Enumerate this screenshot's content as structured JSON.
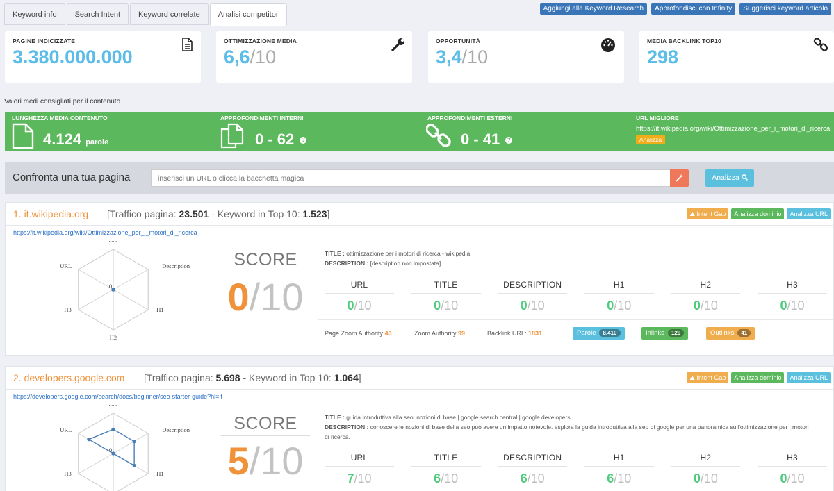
{
  "tabs": [
    "Keyword info",
    "Search Intent",
    "Keyword correlate",
    "Analisi competitor"
  ],
  "top_buttons": [
    "Aggiungi alla Keyword Research",
    "Approfondisci con Infinity",
    "Suggerisci keyword articolo"
  ],
  "cards": [
    {
      "label": "PAGINE INDICIZZATE",
      "value": "3.380.000.000",
      "den": "",
      "icon": "document-icon"
    },
    {
      "label": "OTTIMIZZAZIONE MEDIA",
      "value": "6,6",
      "den": "/10",
      "icon": "wrench-icon"
    },
    {
      "label": "OPPORTUNITÀ",
      "value": "3,4",
      "den": "/10",
      "icon": "gauge-icon"
    },
    {
      "label": "MEDIA BACKLINK TOP10",
      "value": "298",
      "den": "",
      "icon": "link-icon"
    }
  ],
  "content_subtitle": "Valori medi consigliati per il contenuto",
  "green": {
    "lunghezza": {
      "label": "LUNGHEZZA MEDIA CONTENUTO",
      "value": "4.124",
      "unit": "parole"
    },
    "interni": {
      "label": "APPROFONDIMENTI INTERNI",
      "value": "0 - 62"
    },
    "esterni": {
      "label": "APPROFONDIMENTI ESTERNI",
      "value": "0 - 41"
    },
    "url": {
      "label": "URL MIGLIORE",
      "value": "https://it.wikipedia.org/wiki/Ottimizzazione_per_i_motori_di_ricerca",
      "button": "Analizza"
    },
    "help": "?"
  },
  "compare": {
    "title": "Confronta una tua pagina",
    "placeholder": "inserisci un URL o clicca la bacchetta magica",
    "button": "Analizza"
  },
  "results": [
    {
      "rank": "1.",
      "domain": "it.wikipedia.org",
      "stats_prefix": "[Traffico pagina: ",
      "traffic": "23.501",
      "stats_mid": " - Keyword in Top 10: ",
      "keywords": "1.523",
      "stats_suffix": "]",
      "buttons": [
        "Intent Gap",
        "Analizza dominio",
        "Analizza URL"
      ],
      "url": "https://it.wikipedia.org/wiki/Ottimizzazione_per_i_motori_di_ricerca",
      "radar_labels": [
        "Title",
        "Description",
        "H1",
        "H2",
        "H3",
        "URL"
      ],
      "radar_values": [
        0,
        0,
        0,
        0,
        0,
        0
      ],
      "radar_zero": "0",
      "score_label": "SCORE",
      "score": "0",
      "score_den": "/10",
      "title_label": "TITLE :",
      "title_text": "ottimizzazione per i motori di ricerca - wikipedia",
      "desc_label": "DESCRIPTION :",
      "desc_text": "[description non impostata]",
      "columns": [
        {
          "name": "URL",
          "value": "0",
          "den": "/10"
        },
        {
          "name": "TITLE",
          "value": "0",
          "den": "/10"
        },
        {
          "name": "DESCRIPTION",
          "value": "0",
          "den": "/10"
        },
        {
          "name": "H1",
          "value": "0",
          "den": "/10"
        },
        {
          "name": "H2",
          "value": "0",
          "den": "/10"
        },
        {
          "name": "H3",
          "value": "0",
          "den": "/10"
        }
      ],
      "metrics": {
        "pza_label": "Page Zoom Authority",
        "pza": "43",
        "za_label": "Zoom Authority",
        "za": "99",
        "bl_label": "Backlink URL:",
        "bl": "1831",
        "parole_label": "Parole",
        "parole": "8.410",
        "inlinks_label": "Inlinks",
        "inlinks": "129",
        "outlinks_label": "Outlinks",
        "outlinks": "41"
      }
    },
    {
      "rank": "2.",
      "domain": "developers.google.com",
      "stats_prefix": "[Traffico pagina: ",
      "traffic": "5.698",
      "stats_mid": " - Keyword in Top 10: ",
      "keywords": "1.064",
      "stats_suffix": "]",
      "buttons": [
        "Intent Gap",
        "Analizza dominio",
        "Analizza URL"
      ],
      "url": "https://developers.google.com/search/docs/beginner/seo-starter-guide?hl=it",
      "radar_labels": [
        "Title",
        "Description",
        "H1",
        "H2",
        "H3",
        "URL"
      ],
      "radar_values": [
        6,
        6,
        6,
        0,
        0,
        7
      ],
      "radar_zero": "0",
      "score_label": "SCORE",
      "score": "5",
      "score_den": "/10",
      "title_label": "TITLE :",
      "title_text": "guida introduttiva alla seo: nozioni di base | google search central  |  google developers",
      "desc_label": "DESCRIPTION :",
      "desc_text": "conoscere le nozioni di base della seo può avere un impatto notevole. esplora la guida introduttiva alla seo di google per una panoramica sull'ottimizzazione per i motori di ricerca.",
      "columns": [
        {
          "name": "URL",
          "value": "7",
          "den": "/10"
        },
        {
          "name": "TITLE",
          "value": "6",
          "den": "/10"
        },
        {
          "name": "DESCRIPTION",
          "value": "6",
          "den": "/10"
        },
        {
          "name": "H1",
          "value": "6",
          "den": "/10"
        },
        {
          "name": "H2",
          "value": "0",
          "den": "/10"
        },
        {
          "name": "H3",
          "value": "0",
          "den": "/10"
        }
      ]
    }
  ]
}
